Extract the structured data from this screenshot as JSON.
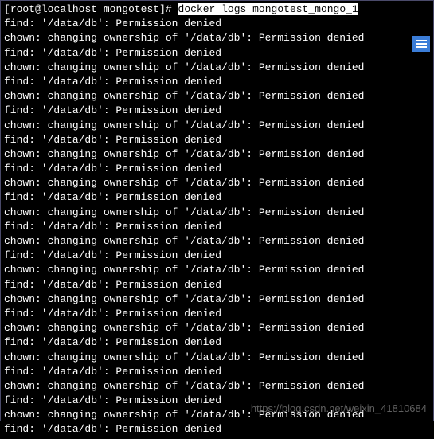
{
  "prompt": {
    "open": "[",
    "user": "root",
    "at": "@",
    "host": "localhost",
    "space": " ",
    "path": "mongotest",
    "close": "]#",
    "command": "docker logs mongotest_mongo_1"
  },
  "lines": [
    "find: '/data/db': Permission denied",
    "chown: changing ownership of '/data/db': Permission denied",
    "find: '/data/db': Permission denied",
    "chown: changing ownership of '/data/db': Permission denied",
    "find: '/data/db': Permission denied",
    "chown: changing ownership of '/data/db': Permission denied",
    "find: '/data/db': Permission denied",
    "chown: changing ownership of '/data/db': Permission denied",
    "find: '/data/db': Permission denied",
    "chown: changing ownership of '/data/db': Permission denied",
    "find: '/data/db': Permission denied",
    "chown: changing ownership of '/data/db': Permission denied",
    "find: '/data/db': Permission denied",
    "chown: changing ownership of '/data/db': Permission denied",
    "find: '/data/db': Permission denied",
    "chown: changing ownership of '/data/db': Permission denied",
    "find: '/data/db': Permission denied",
    "chown: changing ownership of '/data/db': Permission denied",
    "find: '/data/db': Permission denied",
    "chown: changing ownership of '/data/db': Permission denied",
    "find: '/data/db': Permission denied",
    "chown: changing ownership of '/data/db': Permission denied",
    "find: '/data/db': Permission denied",
    "chown: changing ownership of '/data/db': Permission denied",
    "find: '/data/db': Permission denied",
    "chown: changing ownership of '/data/db': Permission denied",
    "find: '/data/db': Permission denied",
    "chown: changing ownership of '/data/db': Permission denied",
    "find: '/data/db': Permission denied"
  ],
  "watermark": "https://blog.csdn.net/weixin_41810684"
}
